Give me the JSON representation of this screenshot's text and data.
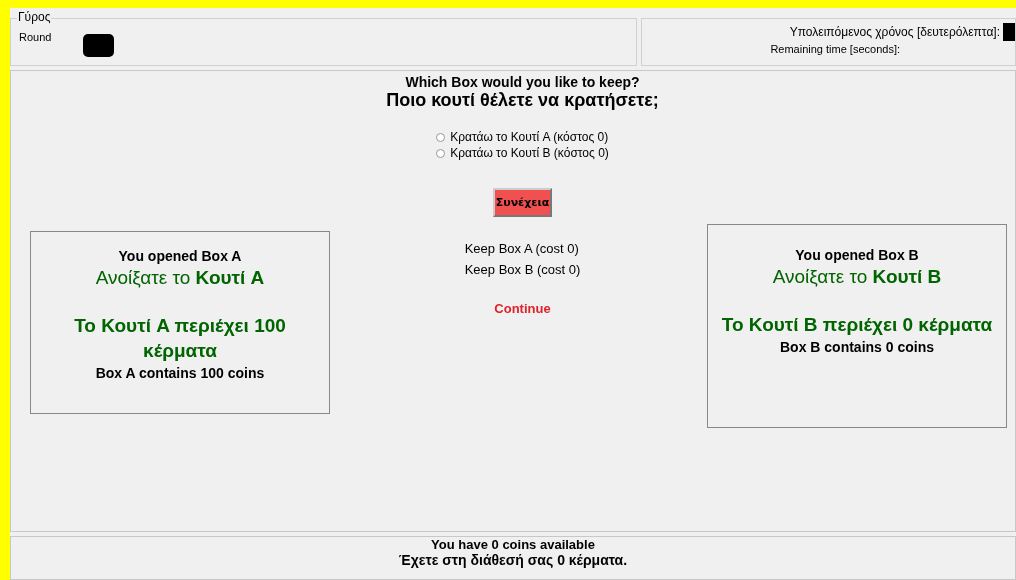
{
  "round_group": {
    "legend": "Γύρος",
    "label": "Round"
  },
  "timer_group": {
    "label_greek": "Υπολειπόμενος χρόνος [δευτερόλεπτα]:",
    "label_english": "Remaining time [seconds]:"
  },
  "question": {
    "english": "Which Box would you like to keep?",
    "greek": "Ποιο κουτί θέλετε να κρατήσετε;"
  },
  "options": [
    {
      "label": "Κρατάω το Κουτί A (κόστος 0)",
      "selected": false
    },
    {
      "label": "Κρατάω το Κουτί B (κόστος 0)",
      "selected": false
    }
  ],
  "continue_button": {
    "label": "Συνέχεια"
  },
  "option_translations": [
    "Keep Box A (cost 0)",
    "Keep Box B (cost 0)"
  ],
  "continue_translation": "Continue",
  "boxes": [
    {
      "opened_english": "You opened Box A",
      "opened_greek": "Ανοίξατε το **Κουτί A**",
      "contents_greek": "Το Κουτί A περιέχει 100 κέρματα",
      "contents_english": "Box A contains 100 coins"
    },
    {
      "opened_english": "You opened Box B",
      "opened_greek": "Ανοίξατε το **Κουτί B**",
      "contents_greek": "Το Κουτί B περιέχει 0 κέρματα",
      "contents_english": "Box B contains 0 coins"
    }
  ],
  "footer": {
    "english": "You have 0 coins available",
    "greek": "Έχετε στη διάθεσή σας 0 κέρματα."
  }
}
